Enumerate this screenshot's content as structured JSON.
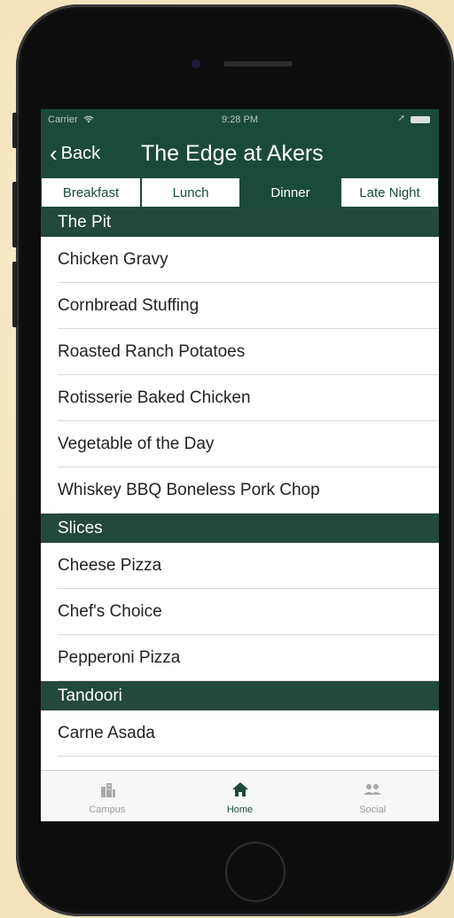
{
  "status": {
    "carrier": "Carrier",
    "time": "9:28 PM"
  },
  "nav": {
    "back_label": "Back",
    "title": "The Edge at Akers"
  },
  "meals": [
    "Breakfast",
    "Lunch",
    "Dinner",
    "Late Night"
  ],
  "selected_meal": "Dinner",
  "sections": [
    {
      "title": "The Pit",
      "items": [
        "Chicken Gravy",
        "Cornbread Stuffing",
        "Roasted Ranch Potatoes",
        "Rotisserie Baked Chicken",
        "Vegetable of the Day",
        "Whiskey BBQ Boneless Pork Chop"
      ]
    },
    {
      "title": "Slices",
      "items": [
        "Cheese Pizza",
        "Chef's Choice",
        "Pepperoni Pizza"
      ]
    },
    {
      "title": "Tandoori",
      "items": [
        "Carne Asada"
      ]
    }
  ],
  "tabs": [
    {
      "label": "Campus",
      "icon": "building-icon"
    },
    {
      "label": "Home",
      "icon": "home-icon"
    },
    {
      "label": "Social",
      "icon": "people-icon"
    }
  ],
  "active_tab": "Home",
  "colors": {
    "primary": "#1b4a3b",
    "section_header": "#22493b",
    "background": "#f3e3bd"
  }
}
